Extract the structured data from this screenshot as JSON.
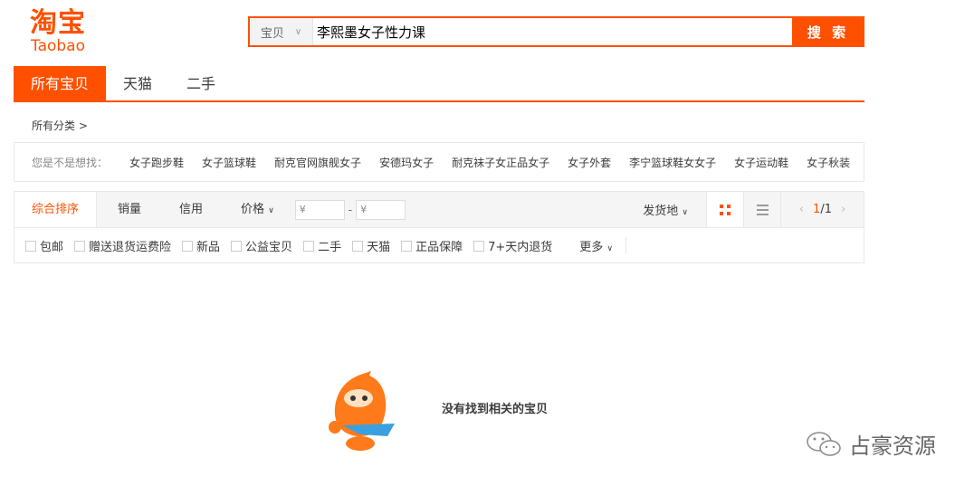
{
  "logo": {
    "cn": "淘宝",
    "en": "Taobao"
  },
  "search": {
    "category": "宝贝",
    "query": "李熙墨女子性力课",
    "button": "搜 索"
  },
  "tabs": [
    "所有宝贝",
    "天猫",
    "二手"
  ],
  "breadcrumb": "所有分类",
  "suggest": {
    "label": "您是不是想找：",
    "items": [
      "女子跑步鞋",
      "女子篮球鞋",
      "耐克官网旗舰女子",
      "安德玛女子",
      "耐克袜子女正品女子",
      "女子外套",
      "李宁篮球鞋女女子",
      "女子运动鞋",
      "女子秋装"
    ]
  },
  "sort": {
    "items": [
      "综合排序",
      "销量",
      "信用",
      "价格"
    ],
    "price_placeholder": "¥",
    "ship": "发货地",
    "page_current": "1",
    "page_total": "/1"
  },
  "filters": [
    "包邮",
    "赠送退货运费险",
    "新品",
    "公益宝贝",
    "二手",
    "天猫",
    "正品保障",
    "7+天内退货"
  ],
  "more": "更多",
  "empty_message": "没有找到相关的宝贝",
  "watermark": "占豪资源",
  "colors": {
    "accent": "#ff5000"
  }
}
